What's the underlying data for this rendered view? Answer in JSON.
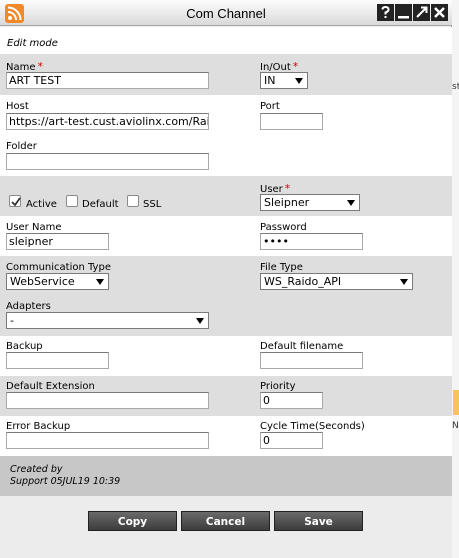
{
  "window": {
    "title": "Com Channel",
    "buttons": [
      "help",
      "minimize",
      "maximize",
      "close"
    ]
  },
  "backdrop": {
    "fragments": [
      "st",
      "No"
    ]
  },
  "form": {
    "mode_label": "Edit mode",
    "name": {
      "label": "Name",
      "value": "ART TEST",
      "required": true
    },
    "in_out": {
      "label": "In/Out",
      "value": "IN",
      "required": true
    },
    "host": {
      "label": "Host",
      "value": "https://art-test.cust.aviolinx.com/RaidoAp"
    },
    "port": {
      "label": "Port",
      "value": ""
    },
    "folder": {
      "label": "Folder",
      "value": ""
    },
    "active": {
      "label": "Active",
      "checked": true
    },
    "default": {
      "label": "Default",
      "checked": false
    },
    "ssl": {
      "label": "SSL",
      "checked": false
    },
    "user": {
      "label": "User",
      "value": "Sleipner",
      "required": true
    },
    "user_name": {
      "label": "User Name",
      "value": "sleipner"
    },
    "password": {
      "label": "Password",
      "value": "••••"
    },
    "communication_type": {
      "label": "Communication Type",
      "value": "WebService"
    },
    "file_type": {
      "label": "File Type",
      "value": "WS_Raido_API"
    },
    "adapters": {
      "label": "Adapters",
      "value": "-"
    },
    "backup": {
      "label": "Backup",
      "value": ""
    },
    "default_filename": {
      "label": "Default filename",
      "value": ""
    },
    "default_extension": {
      "label": "Default Extension",
      "value": ""
    },
    "priority": {
      "label": "Priority",
      "value": "0"
    },
    "error_backup": {
      "label": "Error Backup",
      "value": ""
    },
    "cycle_time": {
      "label": "Cycle Time(Seconds)",
      "value": "0"
    },
    "required_marker": "*"
  },
  "audit": {
    "created_by_label": "Created by",
    "created_by_value": "Support 05JUL19 10:39"
  },
  "footer": {
    "copy": "Copy",
    "cancel": "Cancel",
    "save": "Save"
  }
}
